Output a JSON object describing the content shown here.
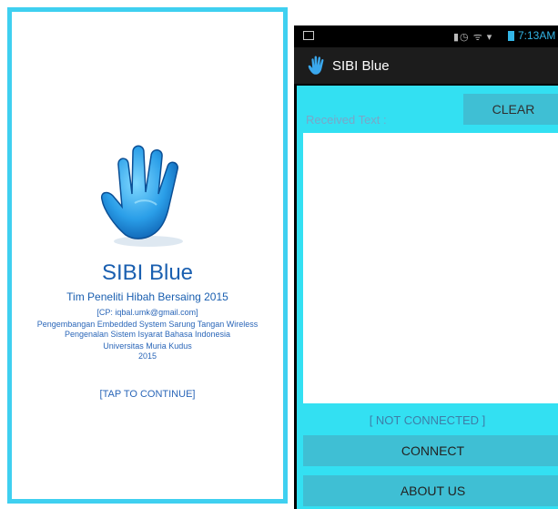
{
  "splash": {
    "app_title": "SIBI Blue",
    "team": "Tim Peneliti Hibah Bersaing 2015",
    "contact": "[CP: iqbal.umk@gmail.com]",
    "line1": "Pengembangan Embedded System Sarung Tangan Wireless",
    "line2": "Pengenalan Sistem Isyarat Bahasa Indonesia",
    "university": "Universitas Muria Kudus",
    "year": "2015",
    "tap": "[TAP TO CONTINUE]",
    "icon": "hand-icon"
  },
  "status_bar": {
    "time": "7:13AM",
    "icons": "alarm-icon, wifi-icon, signal-icon, battery-icon"
  },
  "action_bar": {
    "title": "SIBI Blue",
    "icon": "hand-icon"
  },
  "main": {
    "received_label": "Received Text :",
    "clear_label": "CLEAR",
    "received_text": "",
    "connection_status": "[ NOT CONNECTED ]",
    "connect_label": "CONNECT",
    "about_label": "ABOUT US"
  },
  "colors": {
    "accent_cyan": "#33e0f2",
    "button": "#3fbfd4",
    "title_blue": "#1a5fb0",
    "status_blue": "#33b5e5"
  }
}
